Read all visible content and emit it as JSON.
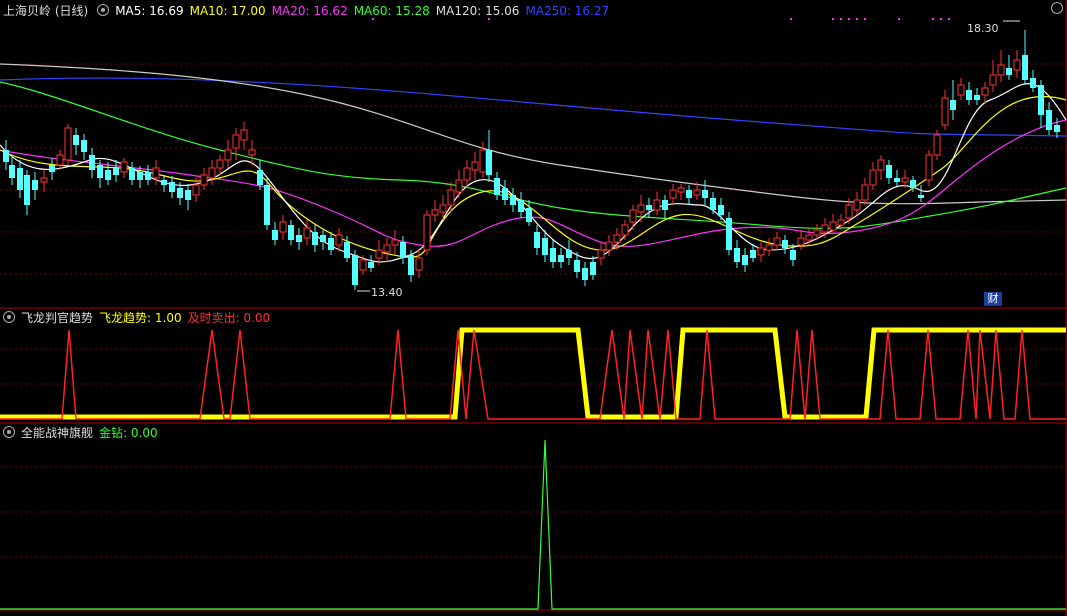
{
  "main_panel": {
    "title": "上海贝岭 (日线)",
    "ma": [
      {
        "label": "MA5: 16.69",
        "color": "#ffffff"
      },
      {
        "label": "MA10: 17.00",
        "color": "#ffff00"
      },
      {
        "label": "MA20: 16.62",
        "color": "#ff33ff"
      },
      {
        "label": "MA60: 15.28",
        "color": "#33ff33"
      },
      {
        "label": "MA120: 15.06",
        "color": "#dddddd"
      },
      {
        "label": "MA250: 16.27",
        "color": "#3344ff"
      }
    ],
    "high_label": "18.30",
    "low_label": "13.40",
    "badge": "财"
  },
  "panel2": {
    "title": "飞龙判官趋势",
    "fields": [
      {
        "label": "飞龙趋势: 1.00",
        "color": "#ffff00"
      },
      {
        "label": "及时卖出: 0.00",
        "color": "#ff3030"
      }
    ]
  },
  "panel3": {
    "title": "全能战神旗舰",
    "fields": [
      {
        "label": "金钻: 0.00",
        "color": "#33ff33"
      }
    ]
  },
  "colors": {
    "up": "#ff3333",
    "down": "#54ffff",
    "grid": "#8b0000",
    "ma5": "#ffffff",
    "ma10": "#ffff00",
    "ma20": "#ff33ff",
    "ma60": "#33ff33",
    "ma120": "#dddddd",
    "ma250": "#3344ff"
  }
}
